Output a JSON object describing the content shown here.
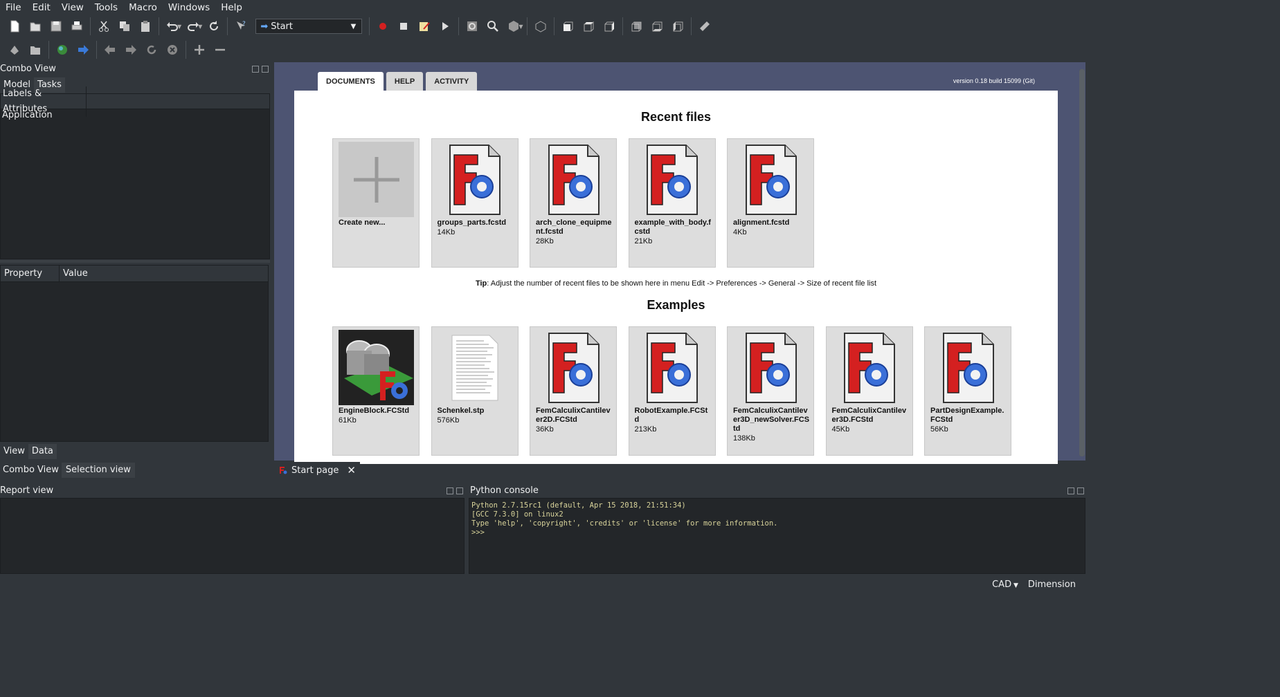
{
  "menu": [
    "File",
    "Edit",
    "View",
    "Tools",
    "Macro",
    "Windows",
    "Help"
  ],
  "toolbar": {
    "workbench": "Start"
  },
  "combo_view": {
    "title": "Combo View",
    "tabs": [
      "Model",
      "Tasks"
    ],
    "tree_header": "Labels & Attributes",
    "tree_root": "Application",
    "prop_headers": [
      "Property",
      "Value"
    ],
    "bottom_tabs": [
      "View",
      "Data"
    ]
  },
  "dock_tabs": [
    "Combo View",
    "Selection view"
  ],
  "start_page": {
    "tabs": [
      "DOCUMENTS",
      "HELP",
      "ACTIVITY"
    ],
    "version": "version 0.18 build 15099 (Git)",
    "recent_title": "Recent files",
    "recent": [
      {
        "name": "Create new...",
        "size": "",
        "icon": "plus-icon"
      },
      {
        "name": "groups_parts.fcstd",
        "size": "14Kb",
        "icon": "freecad-file-icon"
      },
      {
        "name": "arch_clone_equipment.fcstd",
        "size": "28Kb",
        "icon": "freecad-file-icon"
      },
      {
        "name": "example_with_body.fcstd",
        "size": "21Kb",
        "icon": "freecad-file-icon"
      },
      {
        "name": "alignment.fcstd",
        "size": "4Kb",
        "icon": "freecad-file-icon"
      }
    ],
    "tip_bold": "Tip",
    "tip_text": ": Adjust the number of recent files to be shown here in menu Edit -> Preferences -> General -> Size of recent file list",
    "examples_title": "Examples",
    "examples": [
      {
        "name": "EngineBlock.FCStd",
        "size": "61Kb",
        "icon": "engine-block-thumbnail"
      },
      {
        "name": "Schenkel.stp",
        "size": "576Kb",
        "icon": "text-document-icon"
      },
      {
        "name": "FemCalculixCantilever2D.FCStd",
        "size": "36Kb",
        "icon": "freecad-file-icon"
      },
      {
        "name": "RobotExample.FCStd",
        "size": "213Kb",
        "icon": "freecad-file-icon"
      },
      {
        "name": "FemCalculixCantilever3D_newSolver.FCStd",
        "size": "138Kb",
        "icon": "freecad-file-icon"
      },
      {
        "name": "FemCalculixCantilever3D.FCStd",
        "size": "45Kb",
        "icon": "freecad-file-icon"
      },
      {
        "name": "PartDesignExample.FCStd",
        "size": "56Kb",
        "icon": "freecad-file-icon"
      }
    ]
  },
  "document_tab": "Start page",
  "report_view": {
    "title": "Report view"
  },
  "python_console": {
    "title": "Python console",
    "lines": [
      "Python 2.7.15rc1 (default, Apr 15 2018, 21:51:34)",
      "[GCC 7.3.0] on linux2",
      "Type 'help', 'copyright', 'credits' or 'license' for more information.",
      ">>> "
    ]
  },
  "status": {
    "nav_style": "CAD",
    "units": "Dimension"
  },
  "colors": {
    "accent_red": "#d42020",
    "gear_blue": "#3a6fd8",
    "page_bg": "#4d5472"
  }
}
